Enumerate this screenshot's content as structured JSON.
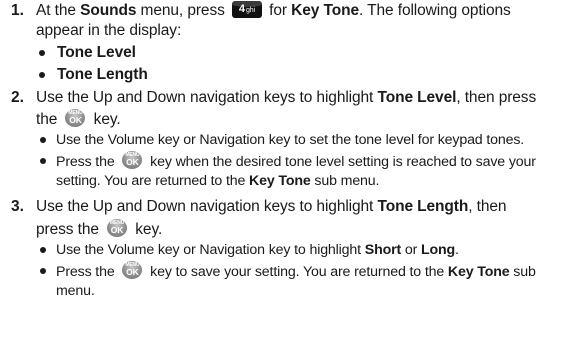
{
  "steps": [
    {
      "number": "1.",
      "l1": [
        "At the ",
        "Sounds",
        " menu, press ",
        " for ",
        "Key Tone",
        ". The following options"
      ],
      "l2": "appear in the display:",
      "options": [
        "Tone Level",
        "Tone Length"
      ]
    },
    {
      "number": "2.",
      "l1": [
        "Use the Up and Down navigation keys to highlight ",
        "Tone Level",
        ", then press"
      ],
      "l2": [
        "the ",
        " key."
      ],
      "b1": "Use the Volume key or Navigation key to set the tone level for keypad tones.",
      "b2_l1": [
        "Press the ",
        " key when the desired tone level setting is reached to save your"
      ],
      "b2_l2": [
        "setting. You are returned to the ",
        "Key Tone",
        " sub menu."
      ]
    },
    {
      "number": "3.",
      "l1": [
        "Use the Up and Down navigation keys to highlight ",
        "Tone Length",
        ", then"
      ],
      "l2": [
        "press the ",
        " key."
      ],
      "b1": [
        "Use the Volume key or Navigation key to highlight ",
        "Short",
        " or ",
        "Long",
        "."
      ],
      "b2_l1": [
        "Press the ",
        " key to save your setting. You are returned to the ",
        "Key Tone",
        " sub"
      ],
      "b2_l2": "menu."
    }
  ],
  "keys": {
    "four_digit": "4",
    "four_letters": "ghi",
    "menu_top": "MENU",
    "menu_bottom": "OK"
  }
}
